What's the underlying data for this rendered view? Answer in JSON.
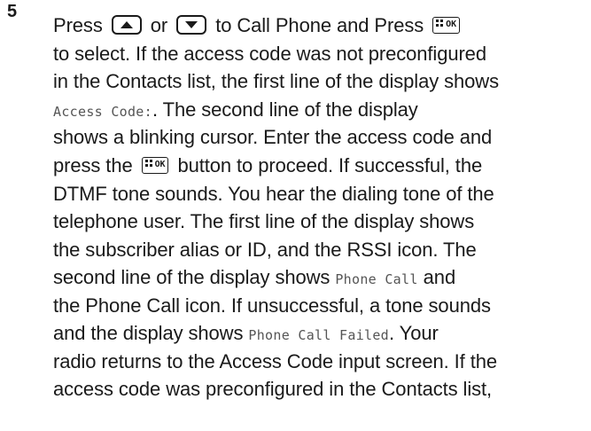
{
  "step_number": "5",
  "paragraph_1": {
    "line1_a": "Press",
    "line1_b": "or",
    "line1_c": "to Call Phone and Press",
    "line2": "to select. If the access code was not preconfigured",
    "line3": "in the Contacts list, the first line of the display shows",
    "line4_mono": "Access Code:",
    "line4_b": ". The second line of the display",
    "line5": "shows a blinking cursor. Enter the access code and"
  },
  "paragraph_2": {
    "line1_a": "press the",
    "line1_b": "button to proceed. If successful, the",
    "line2": "DTMF tone sounds. You hear the dialing tone of the",
    "line3": "telephone user. The first line of the display shows",
    "line4": "the subscriber alias or ID, and the RSSI icon. The",
    "line5_a": "second line of the display shows",
    "line5_mono": "Phone Call",
    "line5_b": "and",
    "line6": "the Phone Call icon. If unsuccessful, a tone sounds",
    "line7_a": "and the display shows",
    "line7_mono": "Phone Call Failed",
    "line7_b": ". Your",
    "line8": "radio returns to the Access Code input screen. If the",
    "line9": "access code was preconfigured in the Contacts list,"
  },
  "keys": {
    "ok_label": "OK",
    "up_icon": "up-arrow-button-icon",
    "down_icon": "down-arrow-button-icon",
    "menu_ok_icon": "menu-ok-button-icon"
  }
}
